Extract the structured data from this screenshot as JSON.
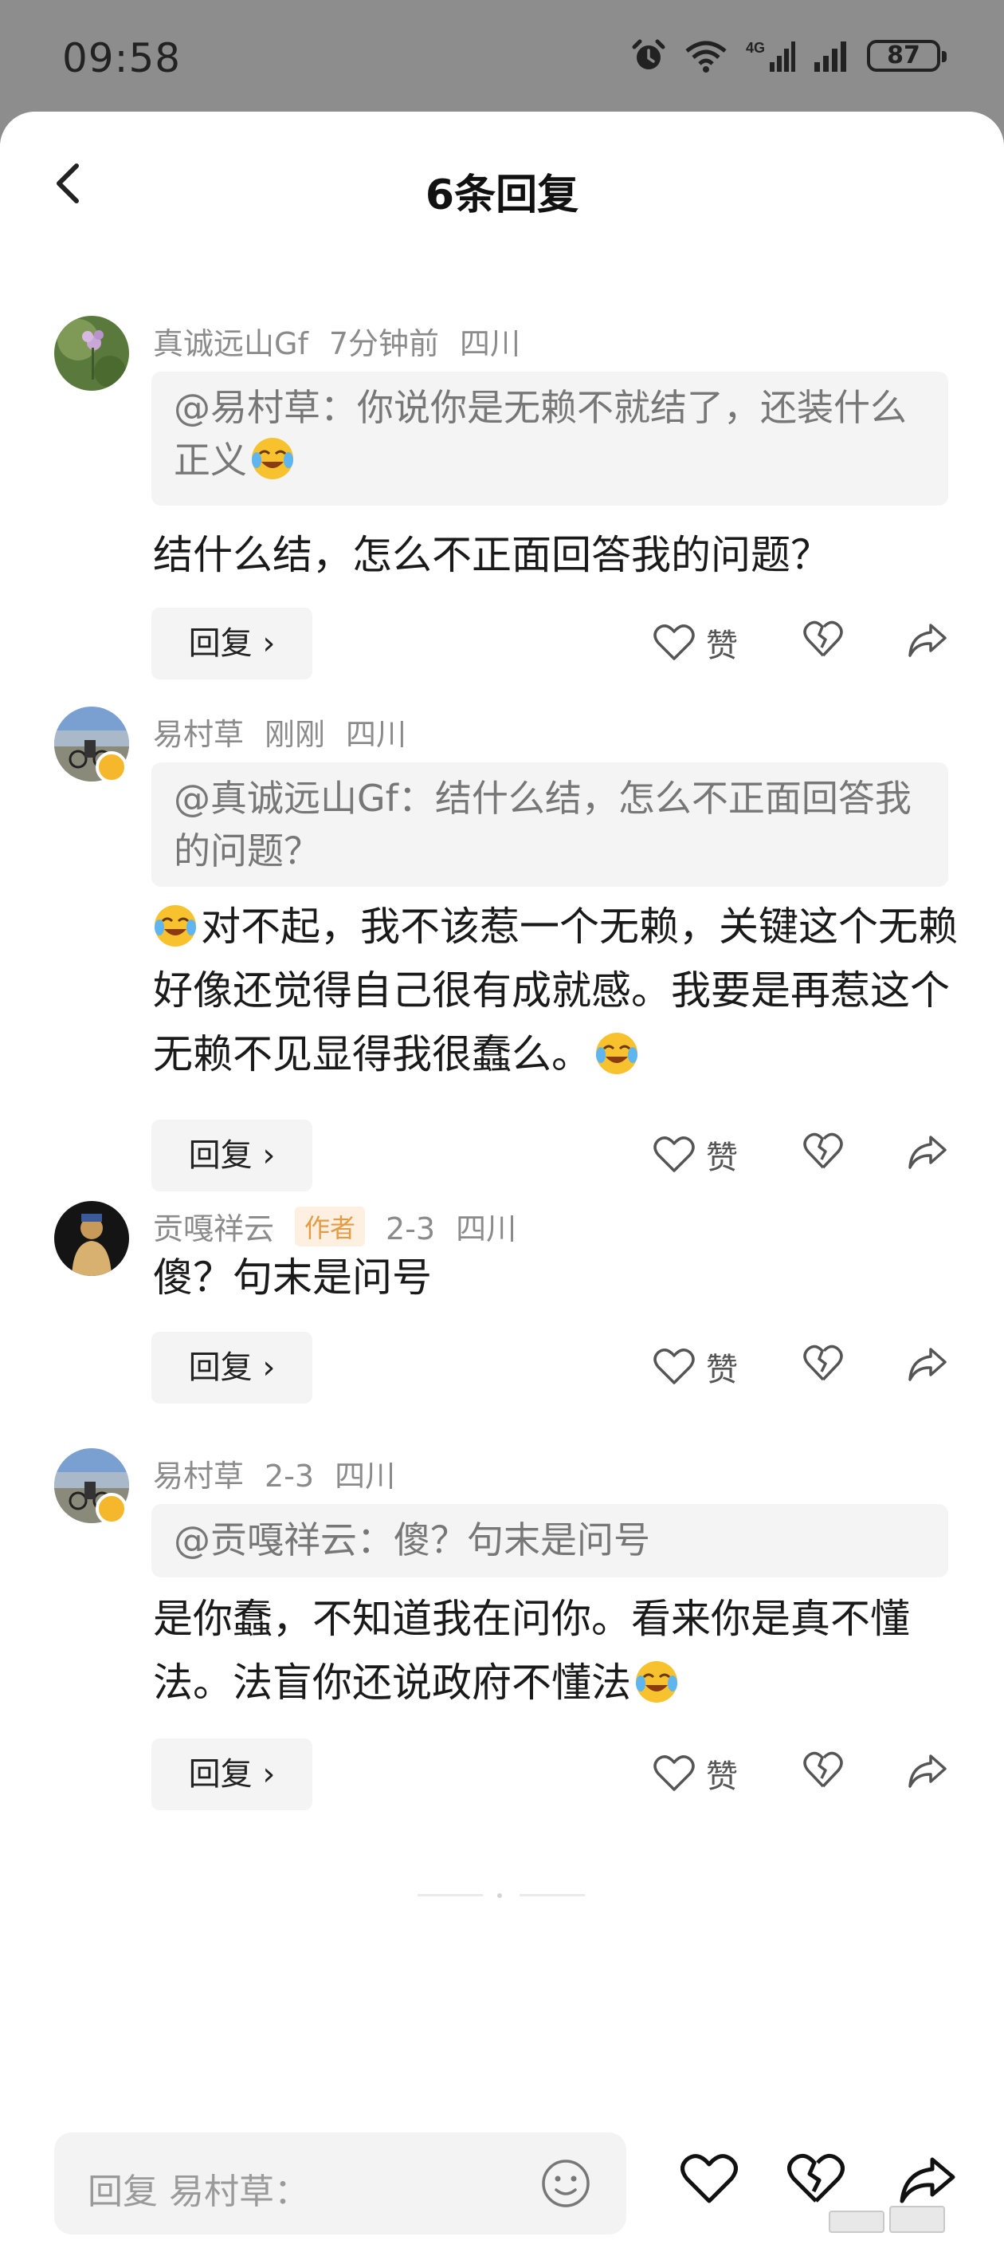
{
  "status_bar": {
    "time": "09:58",
    "battery": "87",
    "network": "4G"
  },
  "header": {
    "title": "6条回复"
  },
  "comments": [
    {
      "author": "真诚远山Gf",
      "time": "7分钟前",
      "location": "四川",
      "quote": "@易村草：你说你是无赖不就结了，还装什么正义",
      "text": "结什么结，怎么不正面回答我的问题？"
    },
    {
      "author": "易村草",
      "time": "刚刚",
      "location": "四川",
      "quote": "@真诚远山Gf：结什么结，怎么不正面回答我的问题？",
      "text_a": "对不起，我不该惹一个无赖，关键这个无赖好像还觉得自己很有成就感。我要是再惹这个无赖不见显得我很蠢么。"
    },
    {
      "author": "贡嘎祥云",
      "tag": "作者",
      "time": "2-3",
      "location": "四川",
      "text": "傻？句末是问号"
    },
    {
      "author": "易村草",
      "time": "2-3",
      "location": "四川",
      "quote": "@贡嘎祥云：傻？句末是问号",
      "text": "是你蠢，不知道我在问你。看来你是真不懂法。法盲你还说政府不懂法"
    }
  ],
  "actions": {
    "reply_label": "回复 ›",
    "like_label": "赞"
  },
  "composer": {
    "placeholder": "回复 易村草："
  },
  "colors": {
    "author_tag_bg": "#fdf0e0",
    "author_tag_text": "#e39b46",
    "badge": "#f5b72b"
  },
  "icons": [
    "back-icon",
    "alarm-icon",
    "wifi-icon",
    "signal-icon",
    "heart-icon",
    "broken-heart-icon",
    "share-icon",
    "smiley-icon",
    "laugh-cry-emoji"
  ]
}
